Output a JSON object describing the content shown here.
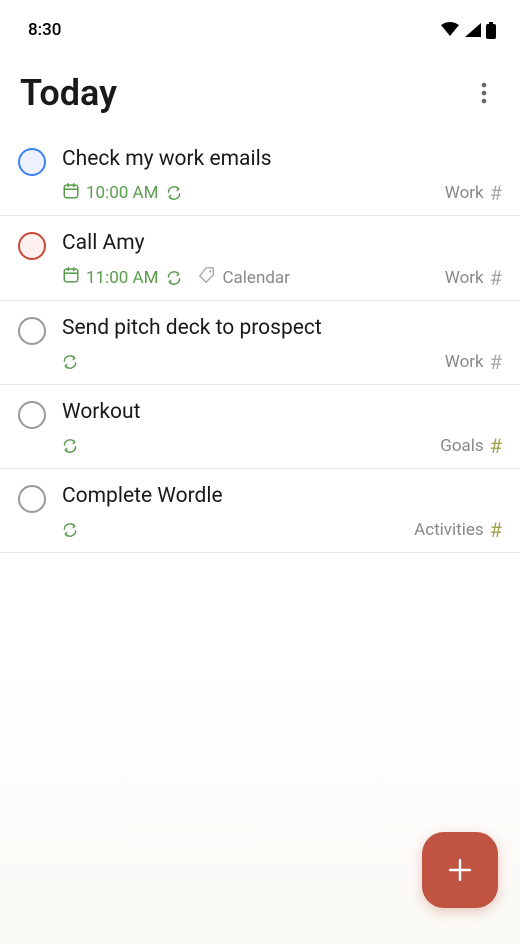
{
  "status": {
    "time": "8:30"
  },
  "header": {
    "title": "Today"
  },
  "tasks": [
    {
      "title": "Check my work emails",
      "time": "10:00 AM",
      "has_time": true,
      "has_recur": true,
      "has_calendar": false,
      "project": "Work",
      "checkbox_color": "blue",
      "hash_color": "gray"
    },
    {
      "title": "Call Amy",
      "time": "11:00 AM",
      "has_time": true,
      "has_recur": true,
      "has_calendar": true,
      "calendar_label": "Calendar",
      "project": "Work",
      "checkbox_color": "red",
      "hash_color": "gray"
    },
    {
      "title": "Send pitch deck to prospect",
      "time": "",
      "has_time": false,
      "has_recur": true,
      "has_calendar": false,
      "project": "Work",
      "checkbox_color": "gray",
      "hash_color": "gray"
    },
    {
      "title": "Workout",
      "time": "",
      "has_time": false,
      "has_recur": true,
      "has_calendar": false,
      "project": "Goals",
      "checkbox_color": "gray",
      "hash_color": "olive"
    },
    {
      "title": "Complete Wordle",
      "time": "",
      "has_time": false,
      "has_recur": true,
      "has_calendar": false,
      "project": "Activities",
      "checkbox_color": "gray",
      "hash_color": "olive"
    }
  ]
}
